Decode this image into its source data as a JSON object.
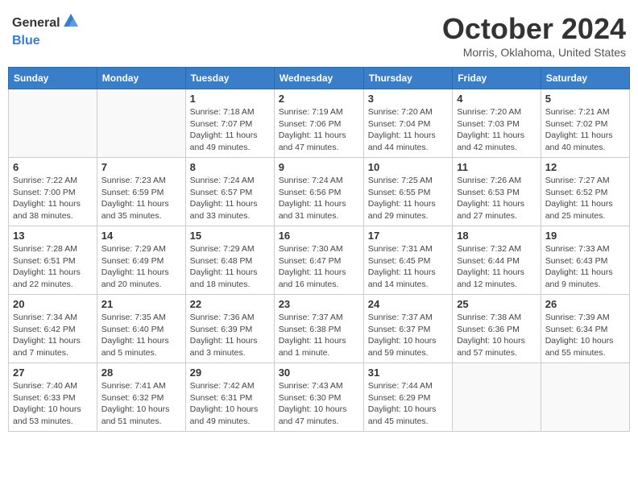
{
  "logo": {
    "general": "General",
    "blue": "Blue"
  },
  "title": "October 2024",
  "location": "Morris, Oklahoma, United States",
  "days_of_week": [
    "Sunday",
    "Monday",
    "Tuesday",
    "Wednesday",
    "Thursday",
    "Friday",
    "Saturday"
  ],
  "weeks": [
    [
      {
        "day": "",
        "info": ""
      },
      {
        "day": "",
        "info": ""
      },
      {
        "day": "1",
        "info": "Sunrise: 7:18 AM\nSunset: 7:07 PM\nDaylight: 11 hours and 49 minutes."
      },
      {
        "day": "2",
        "info": "Sunrise: 7:19 AM\nSunset: 7:06 PM\nDaylight: 11 hours and 47 minutes."
      },
      {
        "day": "3",
        "info": "Sunrise: 7:20 AM\nSunset: 7:04 PM\nDaylight: 11 hours and 44 minutes."
      },
      {
        "day": "4",
        "info": "Sunrise: 7:20 AM\nSunset: 7:03 PM\nDaylight: 11 hours and 42 minutes."
      },
      {
        "day": "5",
        "info": "Sunrise: 7:21 AM\nSunset: 7:02 PM\nDaylight: 11 hours and 40 minutes."
      }
    ],
    [
      {
        "day": "6",
        "info": "Sunrise: 7:22 AM\nSunset: 7:00 PM\nDaylight: 11 hours and 38 minutes."
      },
      {
        "day": "7",
        "info": "Sunrise: 7:23 AM\nSunset: 6:59 PM\nDaylight: 11 hours and 35 minutes."
      },
      {
        "day": "8",
        "info": "Sunrise: 7:24 AM\nSunset: 6:57 PM\nDaylight: 11 hours and 33 minutes."
      },
      {
        "day": "9",
        "info": "Sunrise: 7:24 AM\nSunset: 6:56 PM\nDaylight: 11 hours and 31 minutes."
      },
      {
        "day": "10",
        "info": "Sunrise: 7:25 AM\nSunset: 6:55 PM\nDaylight: 11 hours and 29 minutes."
      },
      {
        "day": "11",
        "info": "Sunrise: 7:26 AM\nSunset: 6:53 PM\nDaylight: 11 hours and 27 minutes."
      },
      {
        "day": "12",
        "info": "Sunrise: 7:27 AM\nSunset: 6:52 PM\nDaylight: 11 hours and 25 minutes."
      }
    ],
    [
      {
        "day": "13",
        "info": "Sunrise: 7:28 AM\nSunset: 6:51 PM\nDaylight: 11 hours and 22 minutes."
      },
      {
        "day": "14",
        "info": "Sunrise: 7:29 AM\nSunset: 6:49 PM\nDaylight: 11 hours and 20 minutes."
      },
      {
        "day": "15",
        "info": "Sunrise: 7:29 AM\nSunset: 6:48 PM\nDaylight: 11 hours and 18 minutes."
      },
      {
        "day": "16",
        "info": "Sunrise: 7:30 AM\nSunset: 6:47 PM\nDaylight: 11 hours and 16 minutes."
      },
      {
        "day": "17",
        "info": "Sunrise: 7:31 AM\nSunset: 6:45 PM\nDaylight: 11 hours and 14 minutes."
      },
      {
        "day": "18",
        "info": "Sunrise: 7:32 AM\nSunset: 6:44 PM\nDaylight: 11 hours and 12 minutes."
      },
      {
        "day": "19",
        "info": "Sunrise: 7:33 AM\nSunset: 6:43 PM\nDaylight: 11 hours and 9 minutes."
      }
    ],
    [
      {
        "day": "20",
        "info": "Sunrise: 7:34 AM\nSunset: 6:42 PM\nDaylight: 11 hours and 7 minutes."
      },
      {
        "day": "21",
        "info": "Sunrise: 7:35 AM\nSunset: 6:40 PM\nDaylight: 11 hours and 5 minutes."
      },
      {
        "day": "22",
        "info": "Sunrise: 7:36 AM\nSunset: 6:39 PM\nDaylight: 11 hours and 3 minutes."
      },
      {
        "day": "23",
        "info": "Sunrise: 7:37 AM\nSunset: 6:38 PM\nDaylight: 11 hours and 1 minute."
      },
      {
        "day": "24",
        "info": "Sunrise: 7:37 AM\nSunset: 6:37 PM\nDaylight: 10 hours and 59 minutes."
      },
      {
        "day": "25",
        "info": "Sunrise: 7:38 AM\nSunset: 6:36 PM\nDaylight: 10 hours and 57 minutes."
      },
      {
        "day": "26",
        "info": "Sunrise: 7:39 AM\nSunset: 6:34 PM\nDaylight: 10 hours and 55 minutes."
      }
    ],
    [
      {
        "day": "27",
        "info": "Sunrise: 7:40 AM\nSunset: 6:33 PM\nDaylight: 10 hours and 53 minutes."
      },
      {
        "day": "28",
        "info": "Sunrise: 7:41 AM\nSunset: 6:32 PM\nDaylight: 10 hours and 51 minutes."
      },
      {
        "day": "29",
        "info": "Sunrise: 7:42 AM\nSunset: 6:31 PM\nDaylight: 10 hours and 49 minutes."
      },
      {
        "day": "30",
        "info": "Sunrise: 7:43 AM\nSunset: 6:30 PM\nDaylight: 10 hours and 47 minutes."
      },
      {
        "day": "31",
        "info": "Sunrise: 7:44 AM\nSunset: 6:29 PM\nDaylight: 10 hours and 45 minutes."
      },
      {
        "day": "",
        "info": ""
      },
      {
        "day": "",
        "info": ""
      }
    ]
  ]
}
